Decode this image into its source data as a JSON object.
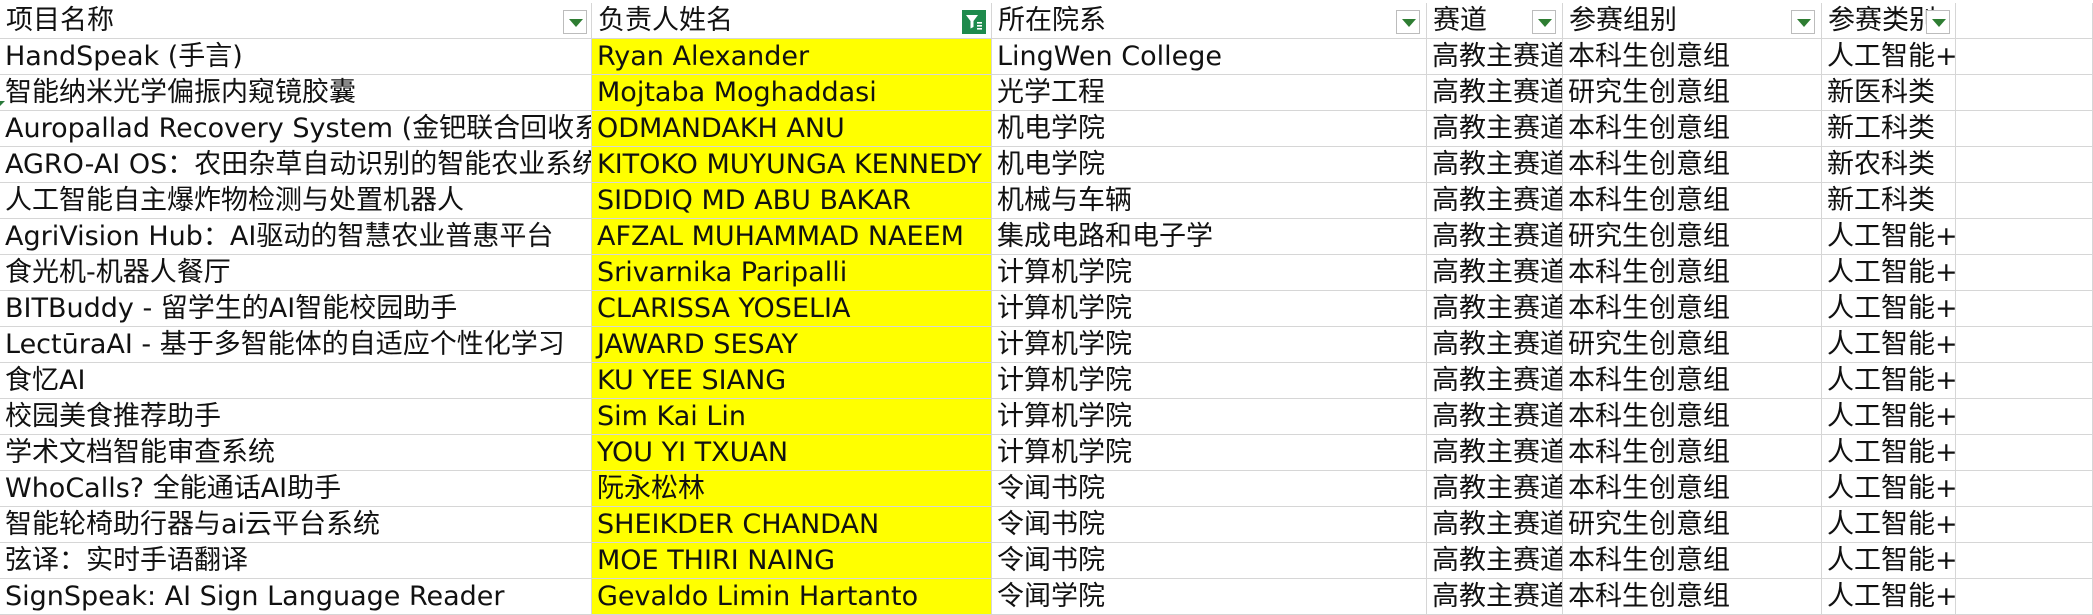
{
  "columns": [
    {
      "label": "项目名称"
    },
    {
      "label": "负责人姓名"
    },
    {
      "label": "所在院系"
    },
    {
      "label": "赛道"
    },
    {
      "label": "参赛组别"
    },
    {
      "label": "参赛类别"
    },
    {
      "label": ""
    }
  ],
  "filters": {
    "active_column": "负责人姓名",
    "highlight_color": "#ffff00",
    "active_filter_color": "#1e8a4c"
  },
  "rows": [
    {
      "name": "HandSpeak (手言)",
      "lead": "Ryan Alexander",
      "dept": "LingWen College",
      "track": "高教主赛道",
      "group": "本科生创意组",
      "category": "人工智能+"
    },
    {
      "name": "智能纳米光学偏振内窥镜胶囊",
      "lead": "Mojtaba Moghaddasi",
      "dept": "光学工程",
      "track": "高教主赛道",
      "group": "研究生创意组",
      "category": "新医科类"
    },
    {
      "name": "Auropallad Recovery System (金钯联合回收系统)",
      "lead": "ODMANDAKH ANU",
      "dept": "机电学院",
      "track": "高教主赛道",
      "group": "本科生创意组",
      "category": "新工科类"
    },
    {
      "name": "AGRO-AI OS：农田杂草自动识别的智能农业系统",
      "lead": "KITOKO MUYUNGA KENNEDY",
      "dept": "机电学院",
      "track": "高教主赛道",
      "group": "本科生创意组",
      "category": "新农科类"
    },
    {
      "name": "人工智能自主爆炸物检测与处置机器人",
      "lead": "SIDDIQ MD ABU BAKAR",
      "dept": "机械与车辆",
      "track": "高教主赛道",
      "group": "本科生创意组",
      "category": "新工科类"
    },
    {
      "name": "AgriVision Hub：AI驱动的智慧农业普惠平台",
      "lead": "AFZAL MUHAMMAD NAEEM",
      "dept": "集成电路和电子学",
      "track": "高教主赛道",
      "group": "研究生创意组",
      "category": "人工智能+"
    },
    {
      "name": "食光机-机器人餐厅",
      "lead": "Srivarnika Paripalli",
      "dept": "计算机学院",
      "track": "高教主赛道",
      "group": "本科生创意组",
      "category": "人工智能+"
    },
    {
      "name": "BITBuddy - 留学生的AI智能校园助手",
      "lead": "CLARISSA YOSELIA",
      "dept": "计算机学院",
      "track": "高教主赛道",
      "group": "本科生创意组",
      "category": "人工智能+"
    },
    {
      "name": "LectūraAI - 基于多智能体的自适应个性化学习",
      "lead": "JAWARD SESAY",
      "dept": "计算机学院",
      "track": "高教主赛道",
      "group": "研究生创意组",
      "category": "人工智能+"
    },
    {
      "name": "食忆AI",
      "lead": "KU YEE SIANG",
      "dept": "计算机学院",
      "track": "高教主赛道",
      "group": "本科生创意组",
      "category": "人工智能+"
    },
    {
      "name": "校园美食推荐助手",
      "lead": "Sim Kai Lin",
      "dept": "计算机学院",
      "track": "高教主赛道",
      "group": "本科生创意组",
      "category": "人工智能+"
    },
    {
      "name": "学术文档智能审查系统",
      "lead": "YOU YI TXUAN",
      "dept": "计算机学院",
      "track": "高教主赛道",
      "group": "本科生创意组",
      "category": "人工智能+"
    },
    {
      "name": "WhoCalls? 全能通话AI助手",
      "lead": "阮永松林",
      "dept": "令闻书院",
      "track": "高教主赛道",
      "group": "本科生创意组",
      "category": "人工智能+"
    },
    {
      "name": "智能轮椅助行器与ai云平台系统",
      "lead": "SHEIKDER CHANDAN",
      "dept": "令闻书院",
      "track": "高教主赛道",
      "group": "研究生创意组",
      "category": "人工智能+"
    },
    {
      "name": "弦译：实时手语翻译",
      "lead": "MOE THIRI NAING",
      "dept": "令闻书院",
      "track": "高教主赛道",
      "group": "本科生创意组",
      "category": "人工智能+"
    },
    {
      "name": "SignSpeak: AI Sign Language Reader",
      "lead": "Gevaldo Limin Hartanto",
      "dept": "令闻学院",
      "track": "高教主赛道",
      "group": "本科生创意组",
      "category": "人工智能+"
    }
  ]
}
